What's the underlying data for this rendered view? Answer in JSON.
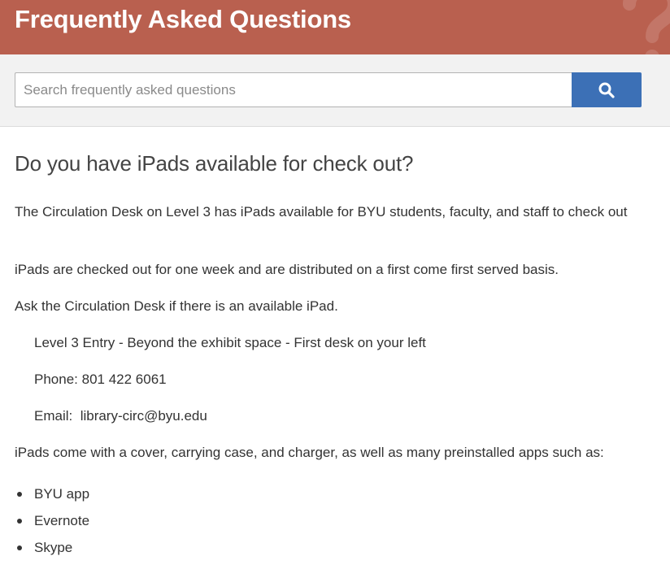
{
  "header": {
    "title": "Frequently Asked Questions"
  },
  "search": {
    "placeholder": "Search frequently asked questions",
    "value": "",
    "button_icon": "search-icon"
  },
  "article": {
    "question": "Do you have iPads available for check out?",
    "paragraphs": [
      "The Circulation Desk on Level 3 has iPads available for BYU students, faculty, and staff to check out",
      "iPads are checked out for one week and are distributed on a first come first served basis.",
      "Ask the Circulation Desk if there is an available iPad."
    ],
    "contact": {
      "location": "Level 3 Entry - Beyond the exhibit space - First desk on your left",
      "phone_label": "Phone:",
      "phone": "801 422 6061",
      "email_label": "Email:",
      "email": "library-circ@byu.edu"
    },
    "apps_intro": "iPads come with a cover, carrying case, and charger, as well as many preinstalled apps such as:",
    "apps": [
      "BYU app",
      "Evernote",
      "Skype"
    ]
  },
  "colors": {
    "banner": "#b9604f",
    "search_button": "#3c70b6",
    "search_band": "#f2f2f2",
    "text": "#333333"
  }
}
